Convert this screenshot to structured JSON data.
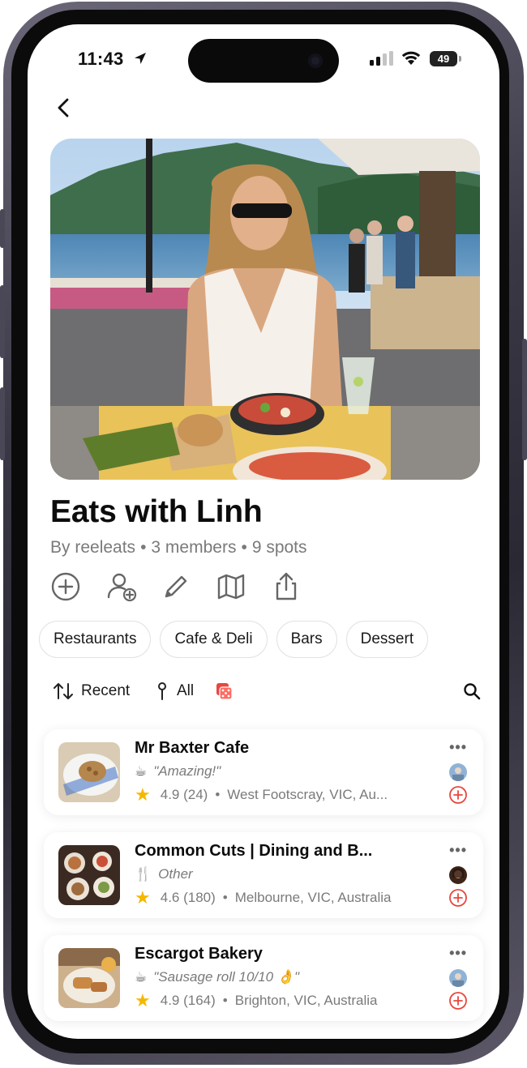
{
  "status_bar": {
    "time": "11:43",
    "battery": "49"
  },
  "collection": {
    "title": "Eats with Linh",
    "author": "By reeleats",
    "members": "3 members",
    "spots": "9 spots"
  },
  "actions": [
    {
      "icon": "add-circle-icon"
    },
    {
      "icon": "add-user-icon"
    },
    {
      "icon": "pencil-icon"
    },
    {
      "icon": "map-icon"
    },
    {
      "icon": "share-icon"
    }
  ],
  "categories": [
    "Restaurants",
    "Cafe & Deli",
    "Bars",
    "Dessert"
  ],
  "toolbar": {
    "sort_label": "Recent",
    "filter_label": "All"
  },
  "places": [
    {
      "name": "Mr Baxter Cafe",
      "note_icon": "☕",
      "note": "\"Amazing!\"",
      "rating": "4.9",
      "reviews": "(24)",
      "location": "West Footscray, VIC, Au..."
    },
    {
      "name": "Common Cuts | Dining and B...",
      "note_icon": "🍴",
      "note": "Other",
      "rating": "4.6",
      "reviews": "(180)",
      "location": "Melbourne, VIC, Australia"
    },
    {
      "name": "Escargot Bakery",
      "note_icon": "☕",
      "note": "\"Sausage roll 10/10 👌\"",
      "rating": "4.9",
      "reviews": "(164)",
      "location": "Brighton, VIC, Australia"
    }
  ],
  "colors": {
    "accent_red": "#e8473f",
    "star": "#f5b800",
    "muted": "#7a7a7a"
  }
}
